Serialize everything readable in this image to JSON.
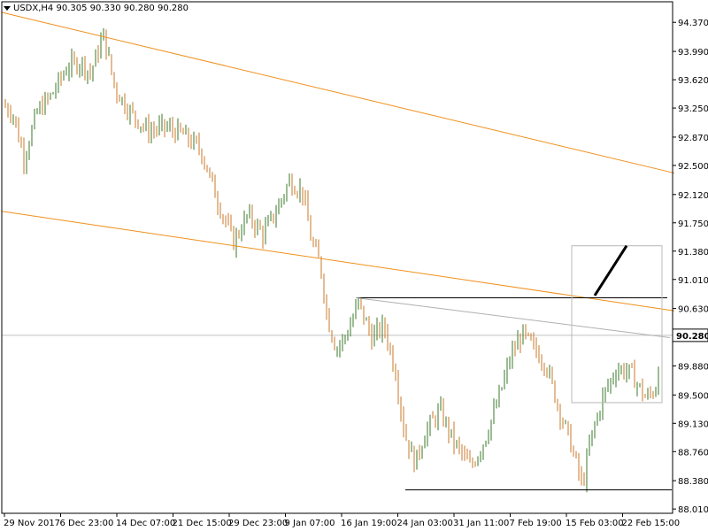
{
  "header": {
    "dropdown_icon": "triangle-down-icon",
    "symbol": "USDX,H4",
    "ohlc": "90.305 90.330 90.280 90.280"
  },
  "chart_data": {
    "type": "candlestick",
    "symbol": "USDX",
    "timeframe": "H4",
    "colors": {
      "bull": "#3a7a2a",
      "bear": "#c8782a",
      "trendline": "#f0901c",
      "level_line": "#000000",
      "grid_h": "#c0c0c0",
      "price_tag_bg": "#ffffff"
    },
    "y_axis": {
      "ylim": [
        88.0,
        94.5
      ],
      "ticks": [
        88.01,
        88.38,
        88.76,
        89.13,
        89.5,
        89.88,
        90.25,
        90.63,
        91.01,
        91.38,
        91.75,
        92.12,
        92.5,
        92.87,
        93.25,
        93.62,
        93.99,
        94.37
      ],
      "tick_labels": [
        "88.010",
        "88.380",
        "88.760",
        "89.130",
        "89.500",
        "89.880",
        "90.250",
        "90.630",
        "91.010",
        "91.380",
        "91.750",
        "92.120",
        "92.500",
        "92.870",
        "93.250",
        "93.620",
        "93.990",
        "94.370"
      ],
      "current_price": 90.28,
      "current_price_label": "90.280"
    },
    "x_axis": {
      "labels": [
        "29 Nov 2017",
        "6 Dec 23:00",
        "14 Dec 07:00",
        "21 Dec 15:00",
        "29 Dec 23:00",
        "9 Jan 07:00",
        "16 Jan 19:00",
        "24 Jan 03:00",
        "31 Jan 11:00",
        "7 Feb 19:00",
        "15 Feb 03:00",
        "22 Feb 15:00"
      ]
    },
    "path": [
      [
        0,
        93.3
      ],
      [
        12,
        93.2
      ],
      [
        25,
        92.6
      ],
      [
        40,
        93.2
      ],
      [
        55,
        93.4
      ],
      [
        75,
        93.8
      ],
      [
        90,
        93.85
      ],
      [
        100,
        93.7
      ],
      [
        115,
        94.2
      ],
      [
        128,
        93.5
      ],
      [
        145,
        93.2
      ],
      [
        165,
        92.95
      ],
      [
        185,
        93.0
      ],
      [
        205,
        92.9
      ],
      [
        225,
        92.7
      ],
      [
        245,
        92.0
      ],
      [
        262,
        91.5
      ],
      [
        278,
        91.85
      ],
      [
        295,
        91.6
      ],
      [
        310,
        91.9
      ],
      [
        325,
        92.3
      ],
      [
        340,
        92.15
      ],
      [
        350,
        91.5
      ],
      [
        360,
        91.2
      ],
      [
        368,
        90.5
      ],
      [
        378,
        90.1
      ],
      [
        390,
        90.3
      ],
      [
        403,
        90.7
      ],
      [
        418,
        90.25
      ],
      [
        432,
        90.4
      ],
      [
        445,
        89.8
      ],
      [
        455,
        89.0
      ],
      [
        467,
        88.6
      ],
      [
        478,
        89.0
      ],
      [
        495,
        89.3
      ],
      [
        510,
        88.9
      ],
      [
        530,
        88.55
      ],
      [
        545,
        88.9
      ],
      [
        560,
        89.4
      ],
      [
        575,
        90.0
      ],
      [
        588,
        90.3
      ],
      [
        602,
        90.1
      ],
      [
        615,
        89.9
      ],
      [
        630,
        89.3
      ],
      [
        642,
        88.9
      ],
      [
        656,
        88.3
      ],
      [
        665,
        88.9
      ],
      [
        680,
        89.5
      ],
      [
        695,
        89.85
      ],
      [
        710,
        89.8
      ],
      [
        728,
        89.45
      ],
      [
        740,
        89.6
      ],
      [
        744,
        90.3
      ]
    ],
    "annotations": [
      {
        "type": "trendline",
        "from": [
          0,
          94.5
        ],
        "to": [
          760,
          92.4
        ]
      },
      {
        "type": "trendline",
        "from": [
          0,
          91.9
        ],
        "to": [
          760,
          90.6
        ]
      },
      {
        "type": "hline",
        "from": [
          400,
          90.77
        ],
        "to": [
          752,
          90.77
        ]
      },
      {
        "type": "hline",
        "from": [
          456,
          88.26
        ],
        "to": [
          757,
          88.26
        ]
      },
      {
        "type": "gray-line",
        "from": [
          400,
          90.77
        ],
        "to": [
          755,
          90.25
        ]
      },
      {
        "type": "rectangle",
        "from": [
          644,
          91.45
        ],
        "to": [
          746,
          89.4
        ]
      },
      {
        "type": "arrow-line",
        "from": [
          670,
          90.8
        ],
        "to": [
          706,
          91.45
        ]
      }
    ]
  }
}
